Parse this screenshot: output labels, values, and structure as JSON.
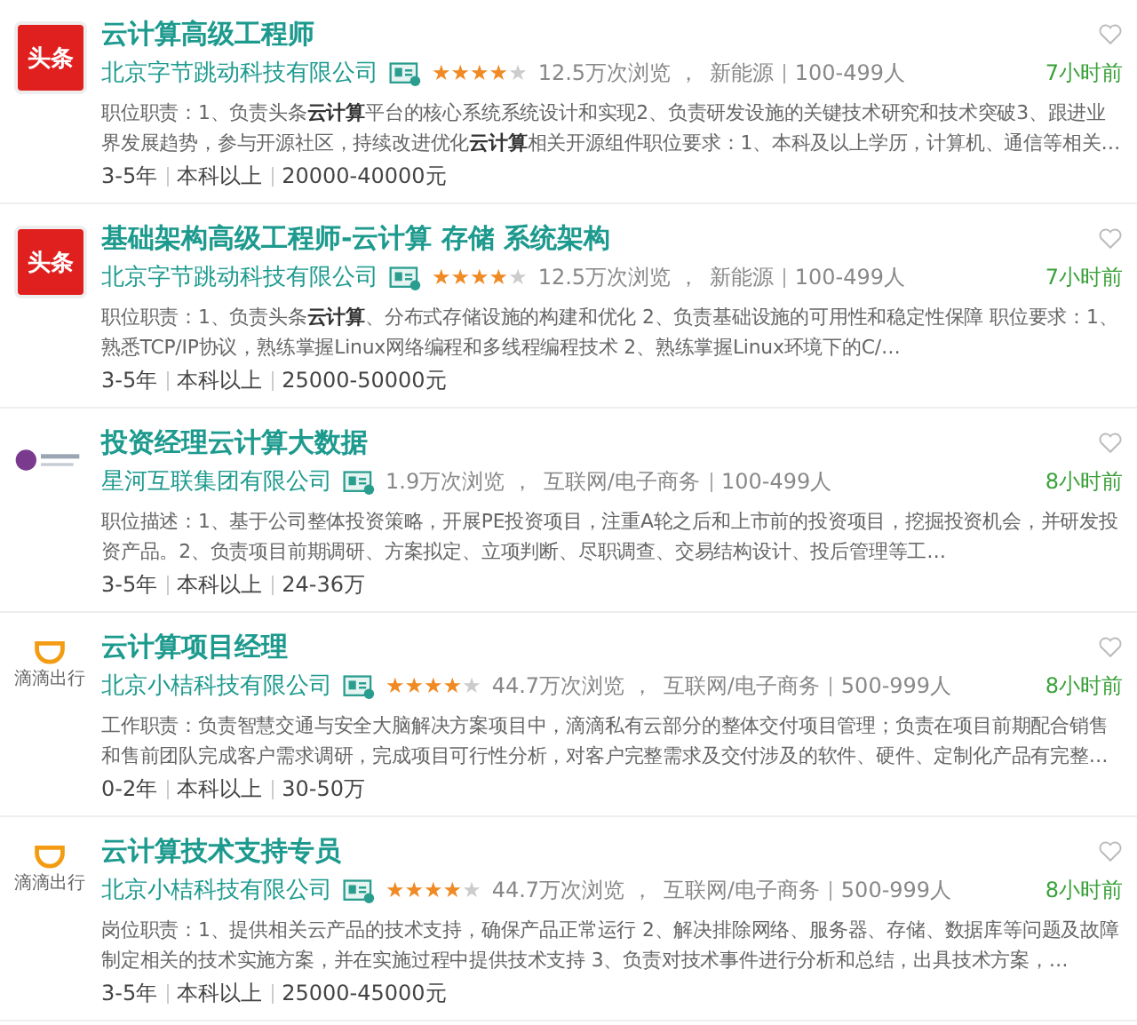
{
  "jobs": [
    {
      "title": "云计算高级工程师",
      "logo": {
        "kind": "toutiao",
        "text": "头条"
      },
      "company": "北京字节跳动科技有限公司",
      "stars": 4,
      "views": "12.5万次浏览 ，",
      "industry": "新能源",
      "size": "100-499人",
      "time": "7小时前",
      "description": "职位职责：1、负责头条**云计算**平台的核心系统系统设计和实现2、负责研发设施的关键技术研究和技术突破3、跟进业界发展趋势，参与开源社区，持续改进优化**云计算**相关开源组件职位要求：1、本科及以上学历，计算机、通信等相关…",
      "experience": "3-5年",
      "education": "本科以上",
      "salary": "20000-40000元"
    },
    {
      "title": "基础架构高级工程师-云计算 存储 系统架构",
      "logo": {
        "kind": "toutiao",
        "text": "头条"
      },
      "company": "北京字节跳动科技有限公司",
      "stars": 4,
      "views": "12.5万次浏览 ，",
      "industry": "新能源",
      "size": "100-499人",
      "time": "7小时前",
      "description": "职位职责：1、负责头条**云计算**、分布式存储设施的构建和优化 2、负责基础设施的可用性和稳定性保障 职位要求：1、熟悉TCP/IP协议，熟练掌握Linux网络编程和多线程编程技术 2、熟练掌握Linux环境下的C/…",
      "experience": "3-5年",
      "education": "本科以上",
      "salary": "25000-50000元"
    },
    {
      "title": "投资经理云计算大数据",
      "logo": {
        "kind": "xinghe"
      },
      "company": "星河互联集团有限公司",
      "views": "1.9万次浏览 ，",
      "industry": "互联网/电子商务",
      "size": "100-499人",
      "time": "8小时前",
      "description": "职位描述：1、基于公司整体投资策略，开展PE投资项目，注重A轮之后和上市前的投资项目，挖掘投资机会，并研发投资产品。2、负责项目前期调研、方案拟定、立项判断、尽职调查、交易结构设计、投后管理等工…",
      "experience": "3-5年",
      "education": "本科以上",
      "salary": "24-36万"
    },
    {
      "title": "云计算项目经理",
      "logo": {
        "kind": "didi",
        "text": "滴滴出行"
      },
      "company": "北京小桔科技有限公司",
      "stars": 4,
      "views": "44.7万次浏览 ，",
      "industry": "互联网/电子商务",
      "size": "500-999人",
      "time": "8小时前",
      "description": "工作职责：负责智慧交通与安全大脑解决方案项目中，滴滴私有云部分的整体交付项目管理；负责在项目前期配合销售和售前团队完成客户需求调研，完成项目可行性分析，对客户完整需求及交付涉及的软件、硬件、定制化产品有完整…",
      "experience": "0-2年",
      "education": "本科以上",
      "salary": "30-50万"
    },
    {
      "title": "云计算技术支持专员",
      "logo": {
        "kind": "didi",
        "text": "滴滴出行"
      },
      "company": "北京小桔科技有限公司",
      "stars": 4,
      "views": "44.7万次浏览 ，",
      "industry": "互联网/电子商务",
      "size": "500-999人",
      "time": "8小时前",
      "description": "岗位职责：1、提供相关云产品的技术支持，确保产品正常运行 2、解决排除网络、服务器、存储、数据库等问题及故障制定相关的技术实施方案，并在实施过程中提供技术支持 3、负责对技术事件进行分析和总结，出具技术方案，…",
      "experience": "3-5年",
      "education": "本科以上",
      "salary": "25000-45000元"
    }
  ]
}
